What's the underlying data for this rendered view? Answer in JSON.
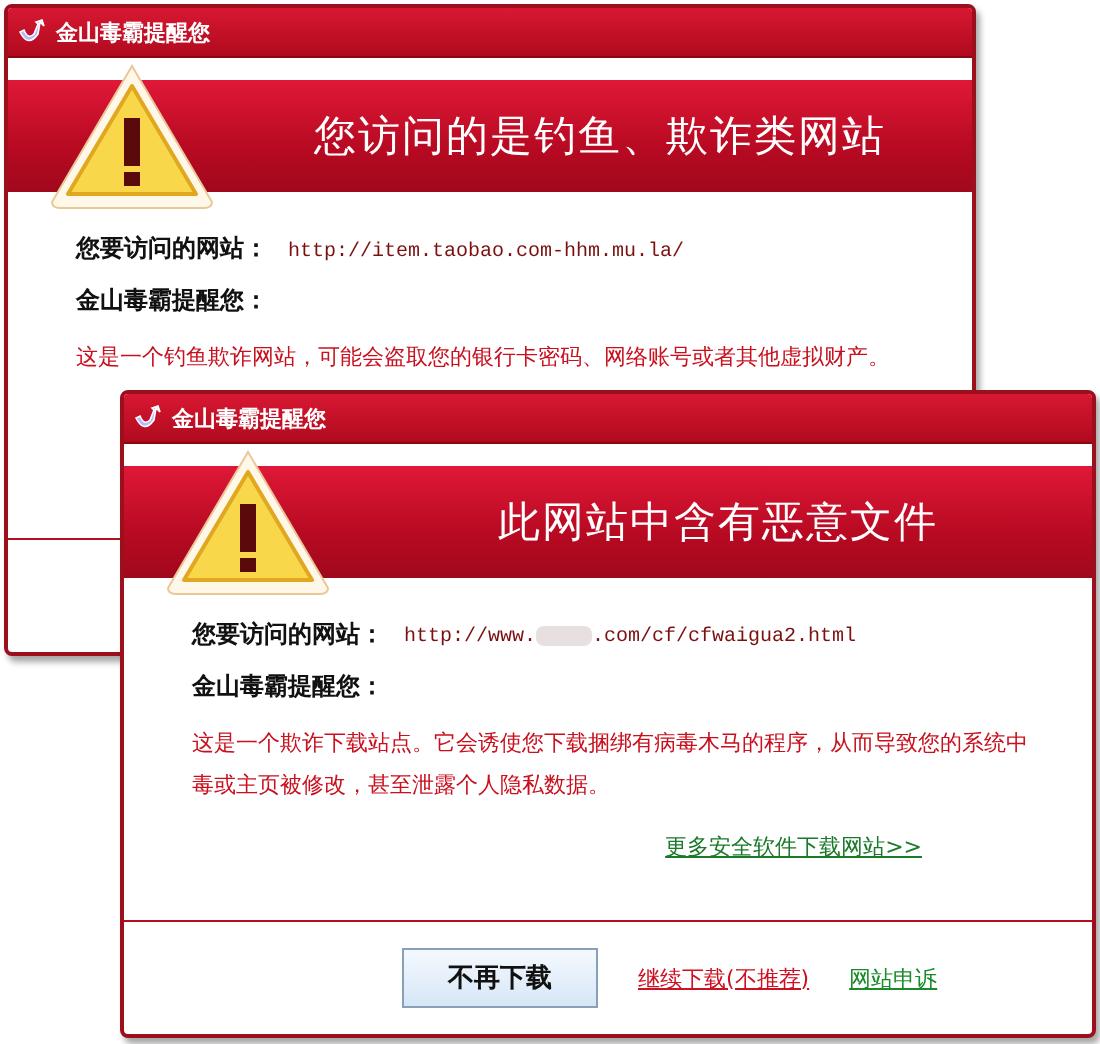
{
  "windows": [
    {
      "title": "金山毒霸提醒您",
      "headline": "您访问的是钓鱼、欺诈类网站",
      "url_label": "您要访问的网站：",
      "url_parts": [
        {
          "kind": "text",
          "text": "http://item.taobao.com-hhm.mu.la/"
        }
      ],
      "notice_heading": "金山毒霸提醒您：",
      "warning": "这是一个钓鱼欺诈网站，可能会盗取您的银行卡密码、网络账号或者其他虚拟财产。"
    },
    {
      "title": "金山毒霸提醒您",
      "headline": "此网站中含有恶意文件",
      "url_label": "您要访问的网站：",
      "url_parts": [
        {
          "kind": "text",
          "text": "http://www."
        },
        {
          "kind": "redacted"
        },
        {
          "kind": "text",
          "text": ".com/cf/cfwaigua2.html"
        }
      ],
      "notice_heading": "金山毒霸提醒您：",
      "warning": "这是一个欺诈下载站点。它会诱使您下载捆绑有病毒木马的程序，从而导致您的系统中毒或主页被修改，甚至泄露个人隐私数据。",
      "more_link": "更多安全软件下载网站>>",
      "actions": [
        {
          "kind": "button",
          "label": "不再下载"
        },
        {
          "kind": "link",
          "label": "继续下载(不推荐)",
          "color": "#cc1122"
        },
        {
          "kind": "link",
          "label": "网站申诉",
          "color": "#1a8a2a"
        }
      ]
    }
  ]
}
